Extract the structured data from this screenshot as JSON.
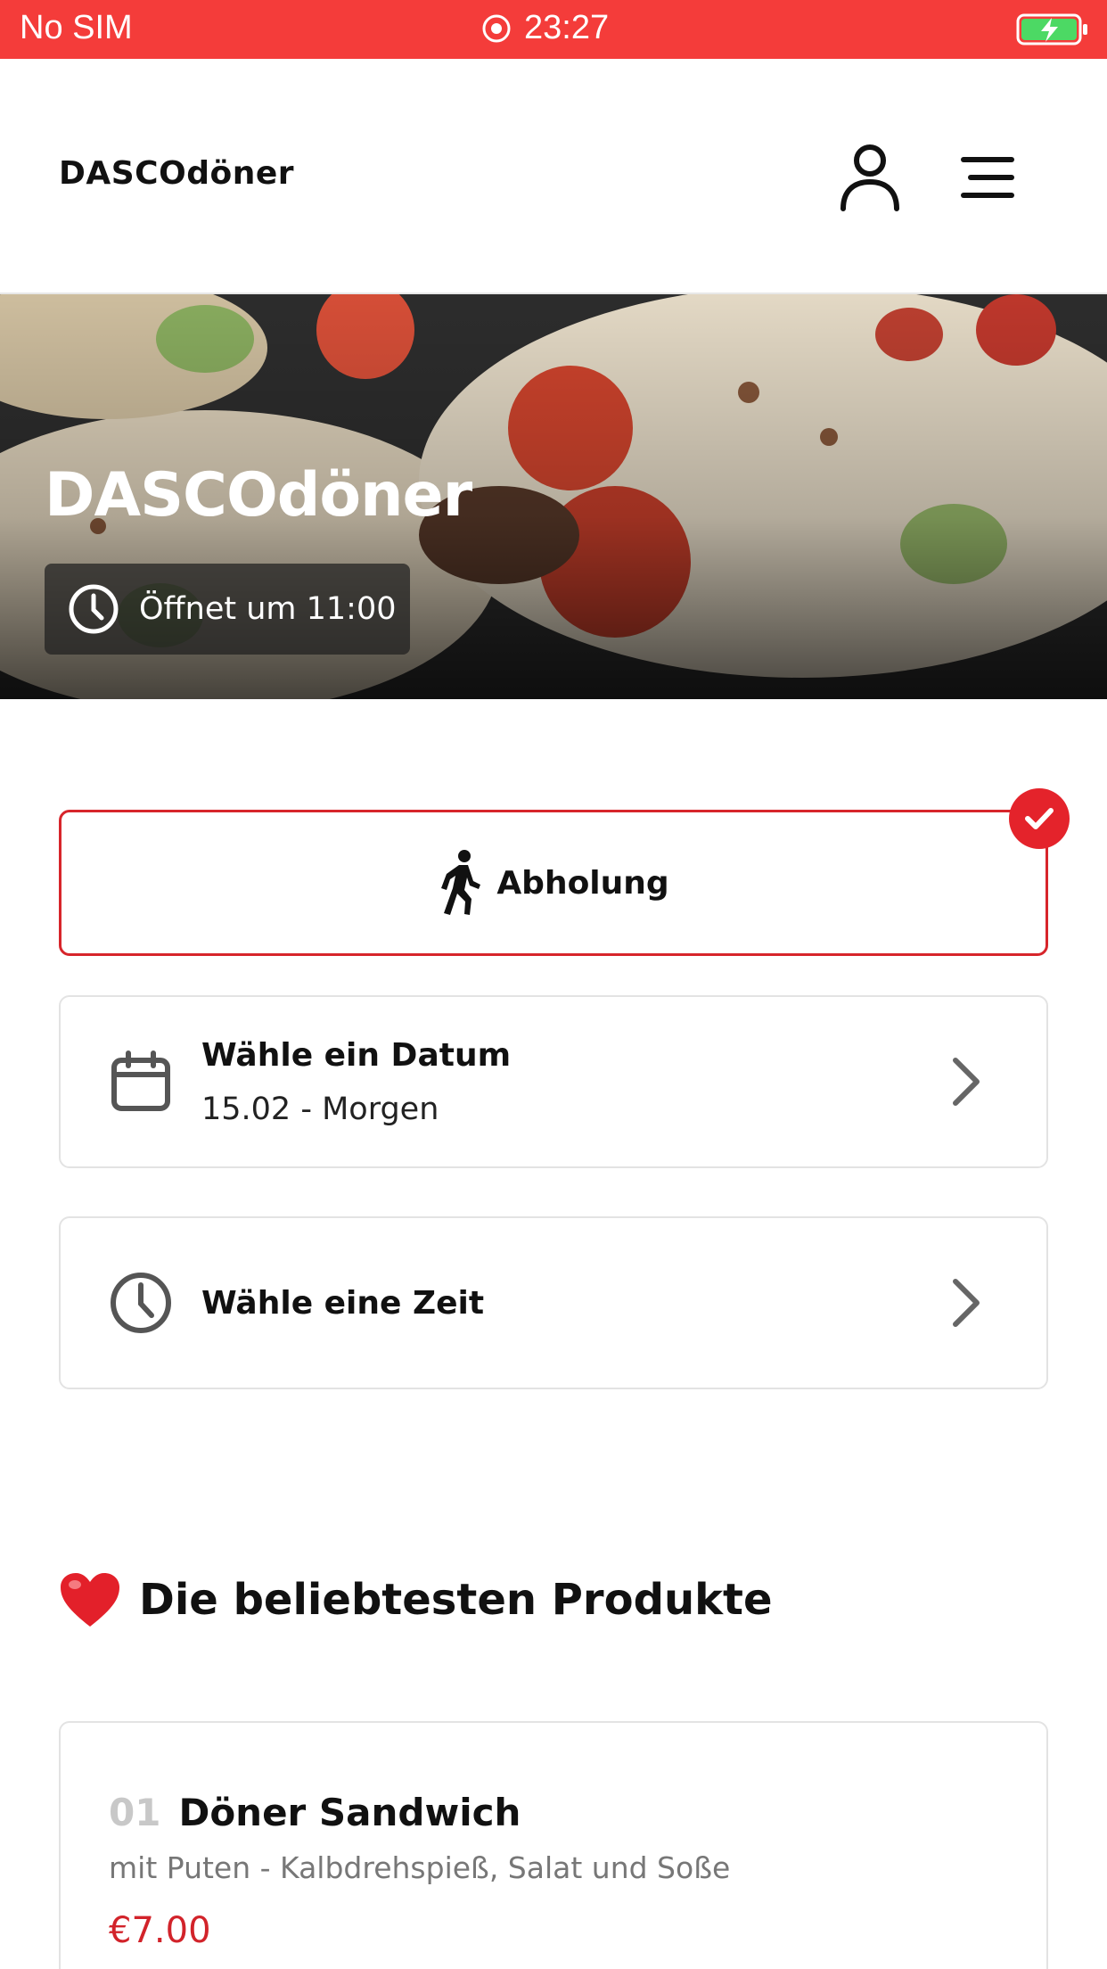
{
  "status_bar": {
    "carrier": "No SIM",
    "time": "23:27",
    "icons": [
      "record-icon",
      "battery-charging-icon"
    ]
  },
  "header": {
    "brand": "DASCOdöner",
    "icons": [
      "user-icon",
      "menu-icon"
    ]
  },
  "hero": {
    "title": "DASCOdöner",
    "badge_text": "Öffnet um 11:00",
    "badge_icon": "clock-icon"
  },
  "order_mode": {
    "label": "Abholung",
    "icon": "walking-person-icon",
    "selected": true
  },
  "date_picker": {
    "title": "Wähle ein Datum",
    "value": "15.02 - Morgen",
    "icon": "calendar-icon"
  },
  "time_picker": {
    "title": "Wähle eine Zeit",
    "icon": "clock-icon"
  },
  "popular": {
    "emoji": "❤️",
    "title": "Die beliebtesten Produkte"
  },
  "products": [
    {
      "number": "01",
      "name": "Döner Sandwich",
      "description": "mit Puten - Kalbdrehspieß, Salat und Soße",
      "price": "€7.00"
    }
  ],
  "colors": {
    "status_bar": "#f43c3a",
    "accent": "#d7252b",
    "price": "#d2232a",
    "battery": "#4cd964"
  }
}
